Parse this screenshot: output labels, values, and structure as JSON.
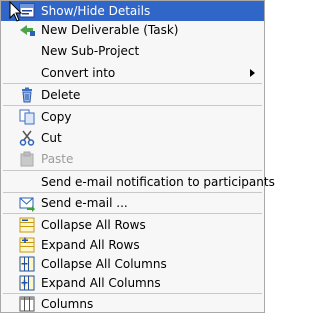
{
  "menu": {
    "show_hide_details": "Show/Hide Details",
    "new_deliverable": "New Deliverable (Task)",
    "new_subproject": "New Sub-Project",
    "convert_into": "Convert into",
    "delete": "Delete",
    "copy": "Copy",
    "cut": "Cut",
    "paste": "Paste",
    "send_notification": "Send e-mail notification to participants",
    "send_email": "Send e-mail ...",
    "collapse_rows": "Collapse All Rows",
    "expand_rows": "Expand All Rows",
    "collapse_columns": "Collapse All Columns",
    "expand_columns": "Expand All Columns",
    "columns": "Columns"
  },
  "icons": {
    "show_hide": "details-panel-icon",
    "new_deliverable": "new-task-icon",
    "delete": "trash-icon",
    "copy": "copy-icon",
    "cut": "scissors-icon",
    "paste": "clipboard-icon",
    "send_email": "mail-send-icon",
    "collapse_rows": "collapse-rows-icon",
    "expand_rows": "expand-rows-icon",
    "collapse_columns": "collapse-columns-icon",
    "expand_columns": "expand-columns-icon",
    "columns": "columns-icon"
  },
  "colors": {
    "highlight": "#3166c9",
    "menu_bg": "#f7f7f7",
    "disabled_text": "#9c9c9c"
  }
}
